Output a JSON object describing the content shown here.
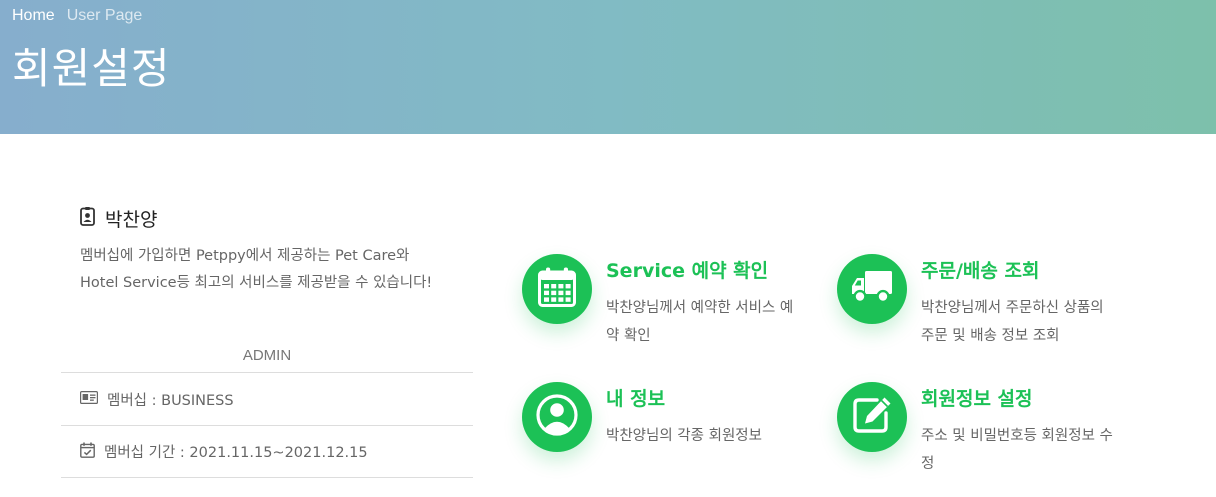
{
  "breadcrumb": {
    "home": "Home",
    "current": "User Page"
  },
  "page": {
    "title": "회원설정"
  },
  "profile": {
    "name": "박찬양",
    "description": "멤버십에 가입하면 Petppy에서 제공하는 Pet Care와 Hotel Service등 최고의 서비스를 제공받을 수 있습니다!",
    "role": "ADMIN",
    "membership": "멤버십 : BUSINESS",
    "period": "멤버십 기간 : 2021.11.15~2021.12.15"
  },
  "features": [
    {
      "icon": "calendar-icon",
      "title": "Service 예약 확인",
      "desc": "박찬양님께서 예약한 서비스 예약 확인"
    },
    {
      "icon": "truck-icon",
      "title": "주문/배송 조회",
      "desc": "박찬양님께서 주문하신 상품의 주문 및 배송 정보 조회"
    },
    {
      "icon": "user-circle-icon",
      "title": "내 정보",
      "desc": "박찬양님의 각종 회원정보"
    },
    {
      "icon": "edit-icon",
      "title": "회원정보 설정",
      "desc": "주소 및 비밀번호등 회원정보 수정"
    }
  ],
  "colors": {
    "accent": "#1cc156",
    "hero_start": "#86aecd",
    "hero_end": "#7dc0ab"
  }
}
